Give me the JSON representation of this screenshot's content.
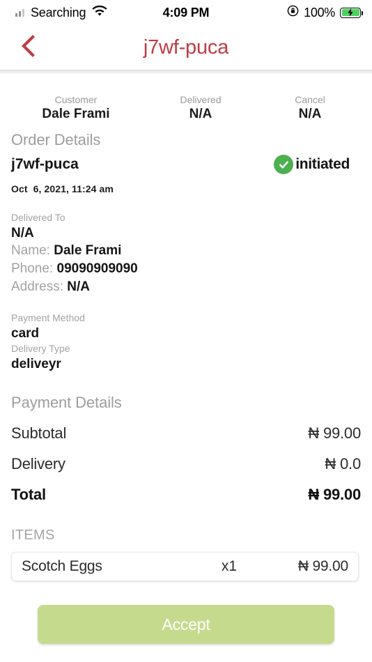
{
  "status_bar": {
    "carrier": "Searching",
    "time": "4:09 PM",
    "battery_percent": "100%",
    "icons": [
      "signal-bars-icon",
      "wifi-icon",
      "rotation-lock-icon",
      "battery-charging-icon"
    ]
  },
  "header": {
    "title": "j7wf-puca",
    "back_icon": "chevron-left-icon",
    "accent_color": "#bf3b44"
  },
  "summary": {
    "columns": [
      {
        "label": "Customer",
        "value": "Dale Frami"
      },
      {
        "label": "Delivered",
        "value": "N/A"
      },
      {
        "label": "Cancel",
        "value": "N/A"
      }
    ]
  },
  "order_details": {
    "section_title": "Order Details",
    "order_id": "j7wf-puca",
    "date": "Oct  6, 2021, 11:24 am",
    "status": {
      "label": "initiated",
      "icon": "check-circle-icon",
      "color": "#4caf50"
    }
  },
  "delivered_to": {
    "label": "Delivered To",
    "value": "N/A",
    "name_label": "Name:",
    "name_value": "Dale Frami",
    "phone_label": "Phone:",
    "phone_value": "09090909090",
    "address_label": "Address:",
    "address_value": "N/A"
  },
  "payment_info": {
    "method_label": "Payment Method",
    "method_value": "card",
    "delivery_type_label": "Delivery Type",
    "delivery_type_value": "deliveyr"
  },
  "payment_details": {
    "section_title": "Payment Details",
    "rows": [
      {
        "label": "Subtotal",
        "amount": "₦ 99.00"
      },
      {
        "label": "Delivery",
        "amount": "₦ 0.0"
      },
      {
        "label": "Total",
        "amount": "₦ 99.00"
      }
    ]
  },
  "items": {
    "section_title": "ITEMS",
    "list": [
      {
        "name": "Scotch Eggs",
        "qty": "x1",
        "price": "₦ 99.00"
      }
    ]
  },
  "footer": {
    "accept_label": "Accept",
    "accept_color": "#c6da8e"
  }
}
